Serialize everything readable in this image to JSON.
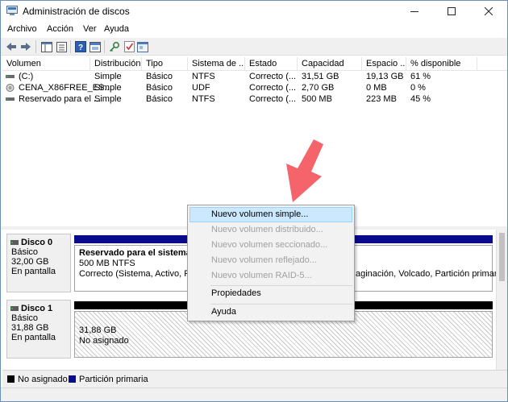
{
  "window": {
    "title": "Administración de discos"
  },
  "menubar": {
    "items": [
      "Archivo",
      "Acción",
      "Ver",
      "Ayuda"
    ]
  },
  "volume_list": {
    "columns": [
      "Volumen",
      "Distribución",
      "Tipo",
      "Sistema de ...",
      "Estado",
      "Capacidad",
      "Espacio ...",
      "% disponible"
    ],
    "rows": [
      [
        "(C:)",
        "Simple",
        "Básico",
        "NTFS",
        "Correcto (...",
        "31,51 GB",
        "19,13 GB",
        "61 %"
      ],
      [
        "CENA_X86FREE_ES...",
        "Simple",
        "Básico",
        "UDF",
        "Correcto (...",
        "2,70 GB",
        "0 MB",
        "0 %"
      ],
      [
        "Reservado para el ...",
        "Simple",
        "Básico",
        "NTFS",
        "Correcto (...",
        "500 MB",
        "223 MB",
        "45 %"
      ]
    ]
  },
  "disks": [
    {
      "name": "Disco 0",
      "type": "Básico",
      "size": "32,00 GB",
      "status": "En pantalla",
      "partition": {
        "title": "Reservado para el sistema",
        "size": "500 MB NTFS",
        "status": "Correcto (Sistema, Activo, Part",
        "status_tail": "aginación, Volcado, Partición primaria"
      }
    },
    {
      "name": "Disco 1",
      "type": "Básico",
      "size": "31,88 GB",
      "status": "En pantalla",
      "partition": {
        "size": "31,88 GB",
        "status": "No asignado"
      }
    }
  ],
  "context_menu": {
    "items": [
      "Nuevo volumen simple...",
      "Nuevo volumen distribuido...",
      "Nuevo volumen seccionado...",
      "Nuevo volumen reflejado...",
      "Nuevo volumen RAID-5...",
      "Propiedades",
      "Ayuda"
    ]
  },
  "legend": {
    "unallocated": "No asignado",
    "primary": "Partición primaria"
  },
  "colors": {
    "primary_partition": "#0a0a8c",
    "unallocated": "#000000",
    "menu_highlight": "#cce8ff",
    "arrow": "#f4646a"
  }
}
